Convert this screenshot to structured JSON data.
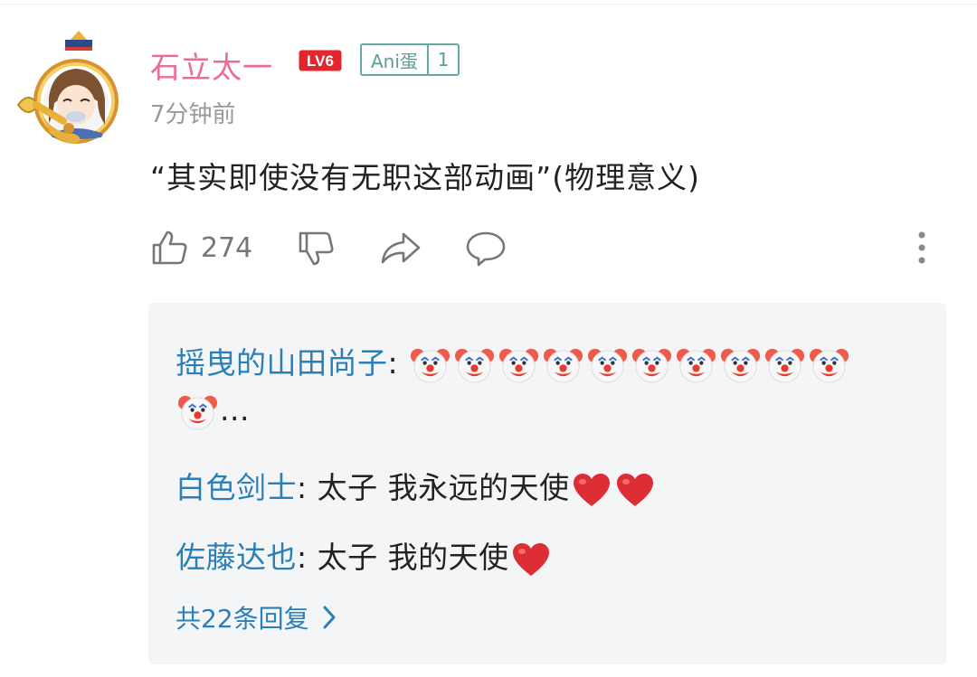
{
  "comment": {
    "username": "石立太一",
    "level_badge": "LV6",
    "medal": {
      "name": "Ani蛋",
      "level": "1"
    },
    "time": "7分钟前",
    "text": "“其实即使没有无职这部动画”(物理意义)",
    "likes": "274"
  },
  "replies": [
    {
      "name": "摇曳的山田尚子",
      "sep": ": ",
      "emoji": "clown",
      "emoji_count": 11,
      "suffix": "..."
    },
    {
      "name": "白色剑士",
      "sep": ": ",
      "text": "太子 我永远的天使",
      "emoji": "heart",
      "emoji_count": 2
    },
    {
      "name": "佐藤达也",
      "sep": ": ",
      "text": "太子 我的天使",
      "emoji": "heart",
      "emoji_count": 1
    }
  ],
  "reply_count_label": "共22条回复",
  "colors": {
    "username": "#e96d94",
    "reply_name": "#2b7fb7",
    "medal": "#64a9a3",
    "level_badge": "#e4252e"
  }
}
